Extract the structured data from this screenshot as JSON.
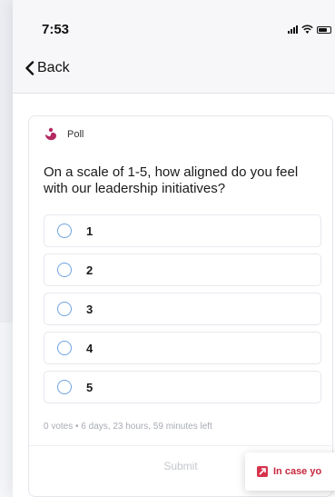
{
  "status_bar": {
    "time": "7:53"
  },
  "nav": {
    "back_label": "Back"
  },
  "poll": {
    "type_label": "Poll",
    "question": "On a scale of 1-5, how aligned do you feel with our leadership initiatives?",
    "options": [
      "1",
      "2",
      "3",
      "4",
      "5"
    ],
    "vote_info": "0 votes • 6 days, 23 hours, 59 minutes left",
    "submit_label": "Submit"
  },
  "banner": {
    "label": "In case yo"
  },
  "colors": {
    "radio_border": "#6fa3e0",
    "banner_accent": "#d8344c",
    "logo": "#b52a63"
  }
}
